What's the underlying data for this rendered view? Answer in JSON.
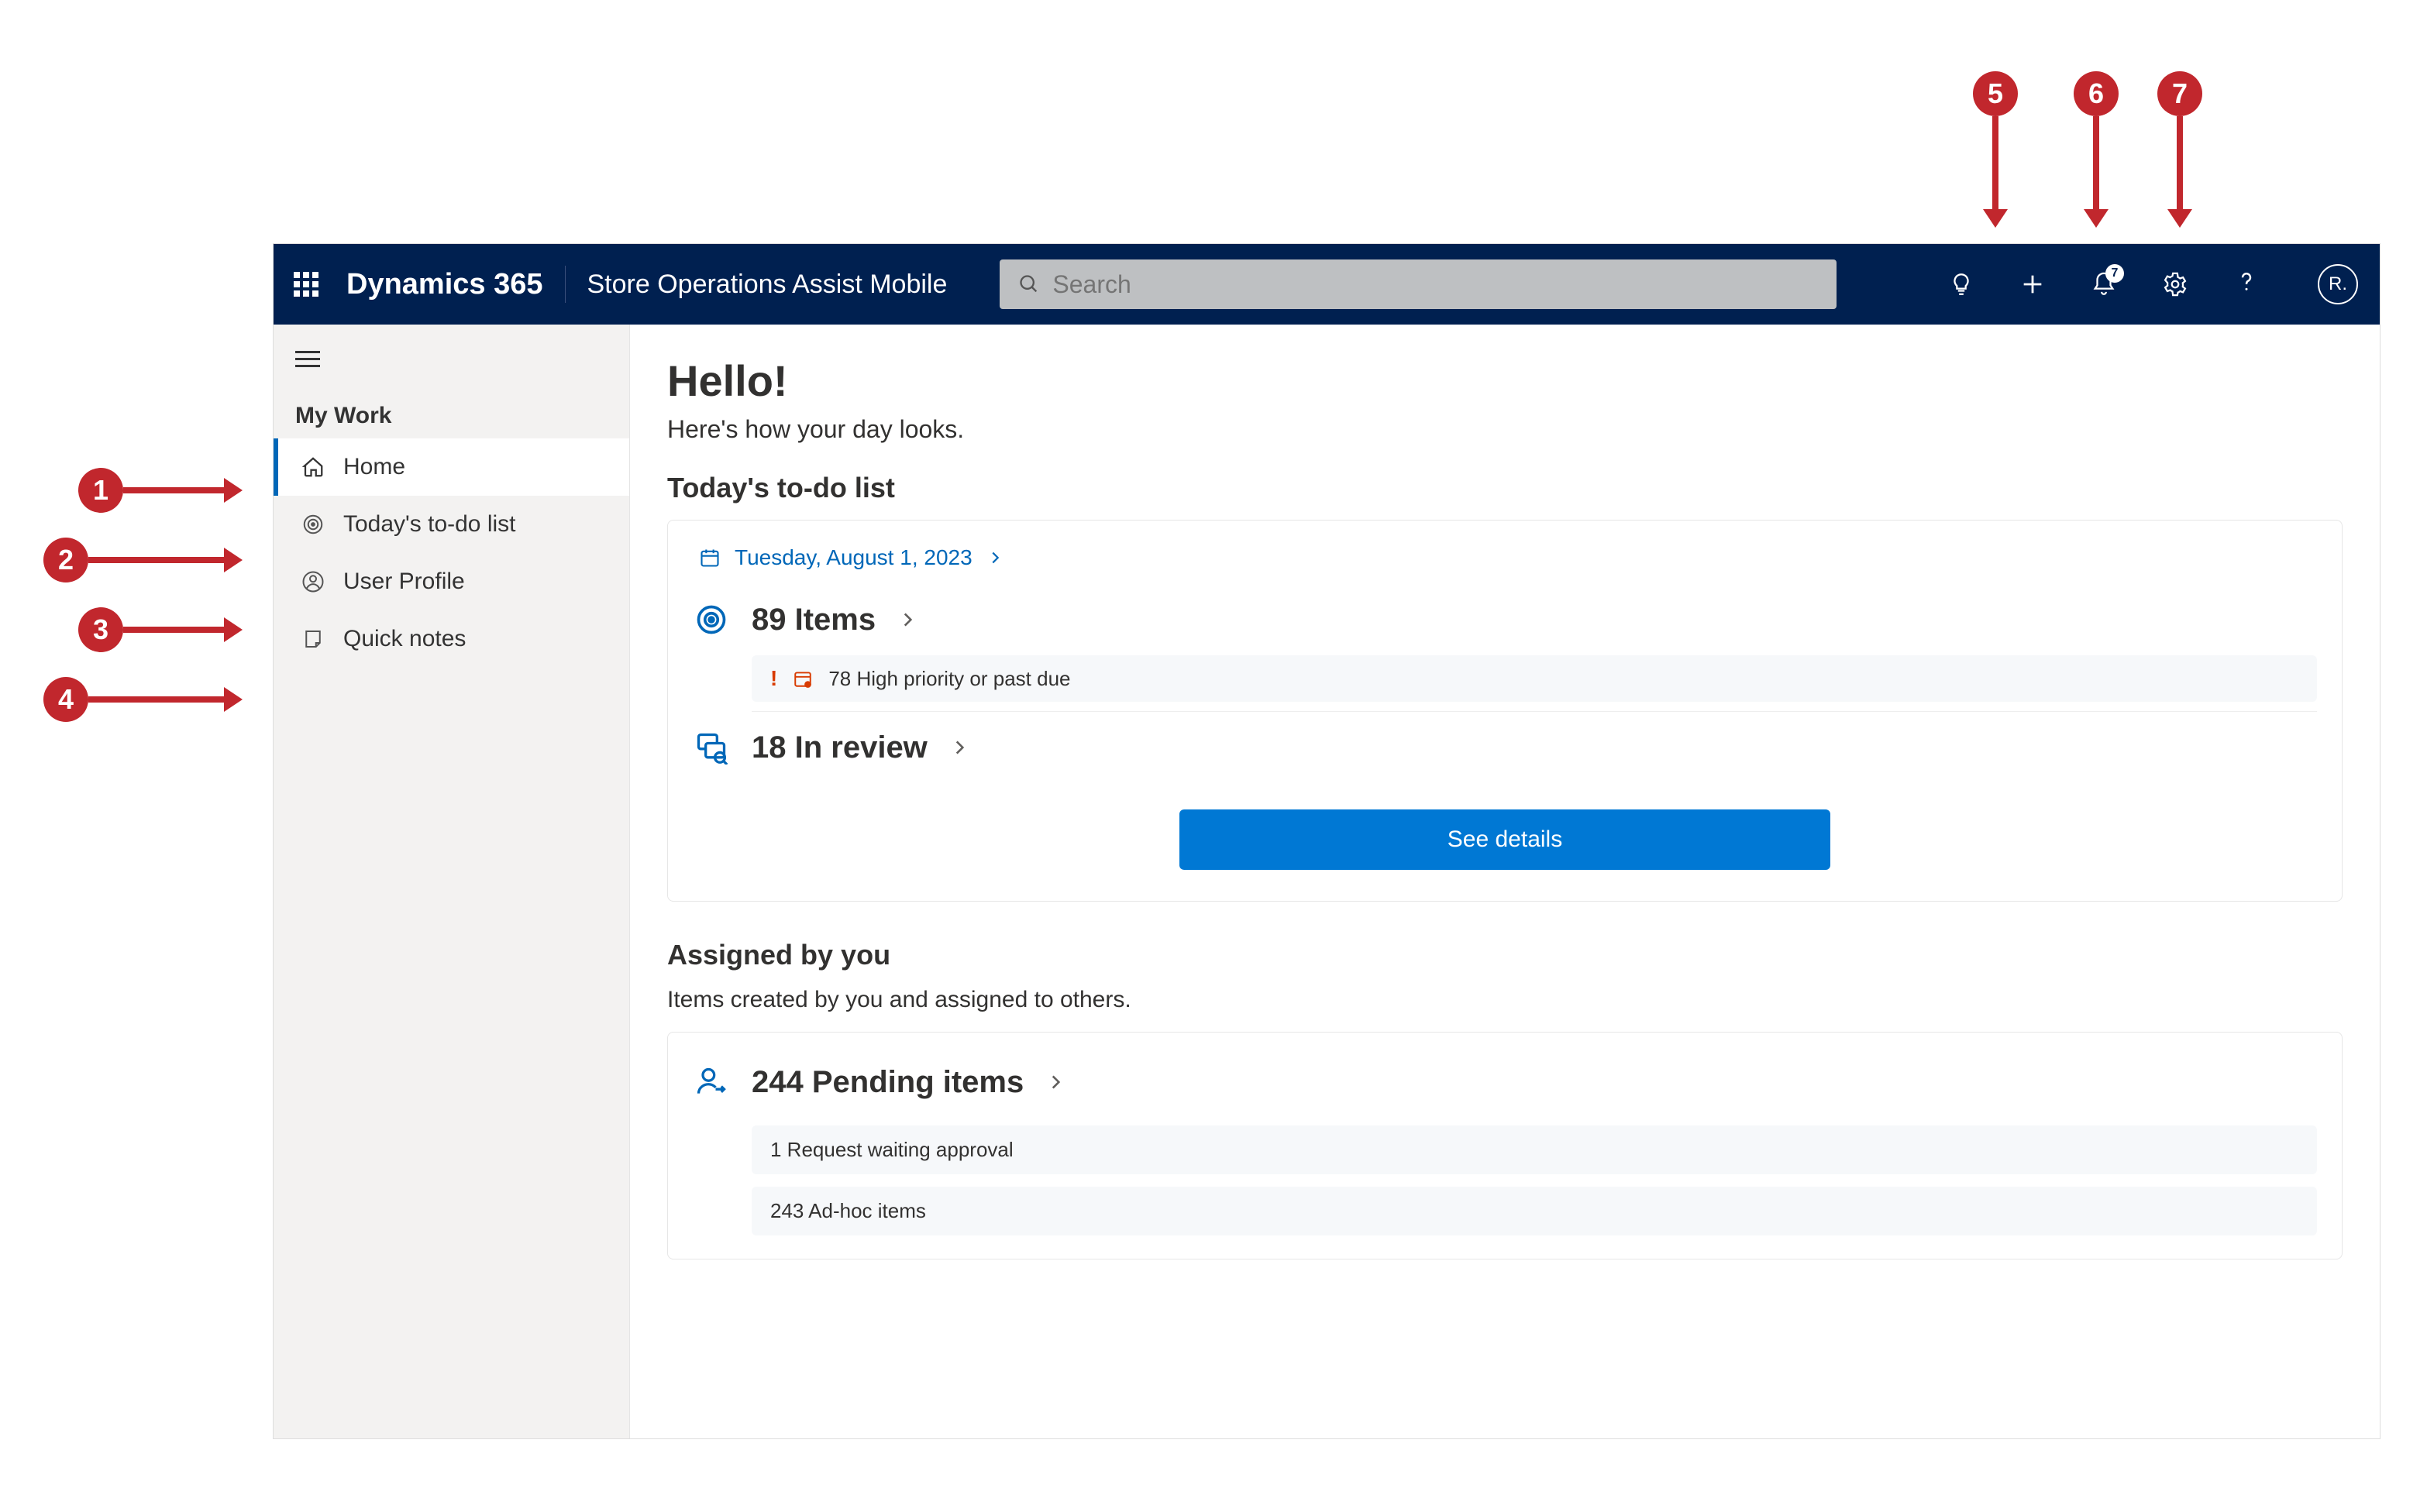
{
  "annotations": {
    "top": [
      "5",
      "6",
      "7"
    ],
    "left": [
      "1",
      "2",
      "3",
      "4"
    ]
  },
  "header": {
    "brand": "Dynamics 365",
    "appname": "Store Operations Assist Mobile",
    "search_placeholder": "Search",
    "notification_count": "7",
    "avatar_initials": "R."
  },
  "sidebar": {
    "section": "My Work",
    "items": [
      {
        "label": "Home",
        "active": true
      },
      {
        "label": "Today's to-do list",
        "active": false
      },
      {
        "label": "User Profile",
        "active": false
      },
      {
        "label": "Quick notes",
        "active": false
      }
    ]
  },
  "main": {
    "greeting": "Hello!",
    "subtitle": "Here's how your day looks.",
    "todo": {
      "heading": "Today's to-do list",
      "date": "Tuesday, August 1, 2023",
      "items_label": "89 Items",
      "alert_text": "78 High priority or past due",
      "review_label": "18 In review",
      "cta": "See details"
    },
    "assigned": {
      "heading": "Assigned by you",
      "desc": "Items created by you and assigned to others.",
      "pending_label": "244 Pending items",
      "sub": [
        "1 Request waiting approval",
        "243 Ad-hoc items"
      ]
    }
  }
}
